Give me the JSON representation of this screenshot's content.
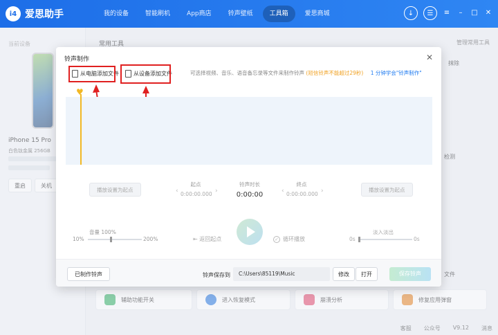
{
  "app": {
    "name": "爱思助手",
    "logo_mark": "i4",
    "nav": [
      "我的设备",
      "智能刷机",
      "App商店",
      "铃声壁纸",
      "工具箱",
      "爱思商城"
    ],
    "active_nav": "工具箱"
  },
  "left": {
    "label": "当前设备",
    "device_name": "iPhone 15 Pro",
    "device_sub": "白色钛金属 256GB",
    "restart": "重启",
    "shutdown": "关机"
  },
  "main": {
    "section_title": "常用工具",
    "manage_link": "管理常用工具",
    "peek_1": "抹除",
    "peek_2": "检测",
    "peek_3": "文件",
    "tiles": [
      "辅助功能开关",
      "进入恢复模式",
      "崩溃分析",
      "修复应用弹窗"
    ]
  },
  "dialog": {
    "title": "铃声制作",
    "add_pc": "从电脑添加文件",
    "add_device": "从设备添加文件",
    "hint": "可选择视频、音乐、语音备忘录等文件来制作铃声",
    "hint_warn": "(短信铃声不能超过29秒)",
    "learn": "1 分钟学会\"铃声制作\"",
    "set_start": "播放设置为起点",
    "set_end": "播放设置为起点",
    "start_label": "起点",
    "start_value": "0:00:00.000",
    "duration_label": "铃声时长",
    "duration_value": "0:00:00",
    "end_label": "终点",
    "end_value": "0:00:00.000",
    "volume_label": "音量 100%",
    "vol_min": "10%",
    "vol_max": "200%",
    "back_to_start": "返回起点",
    "loop": "循环播放",
    "fade": "淡入淡出",
    "fade_min": "0s",
    "fade_max": "0s",
    "made_ringtones": "已制作铃声",
    "save_to_label": "铃声保存到",
    "save_path": "C:\\Users\\85119\\Music",
    "modify": "修改",
    "open": "打开",
    "save": "保存铃声"
  },
  "status": {
    "service": "客服",
    "wechat": "公众号",
    "version": "V9.12",
    "messages": "消息"
  }
}
